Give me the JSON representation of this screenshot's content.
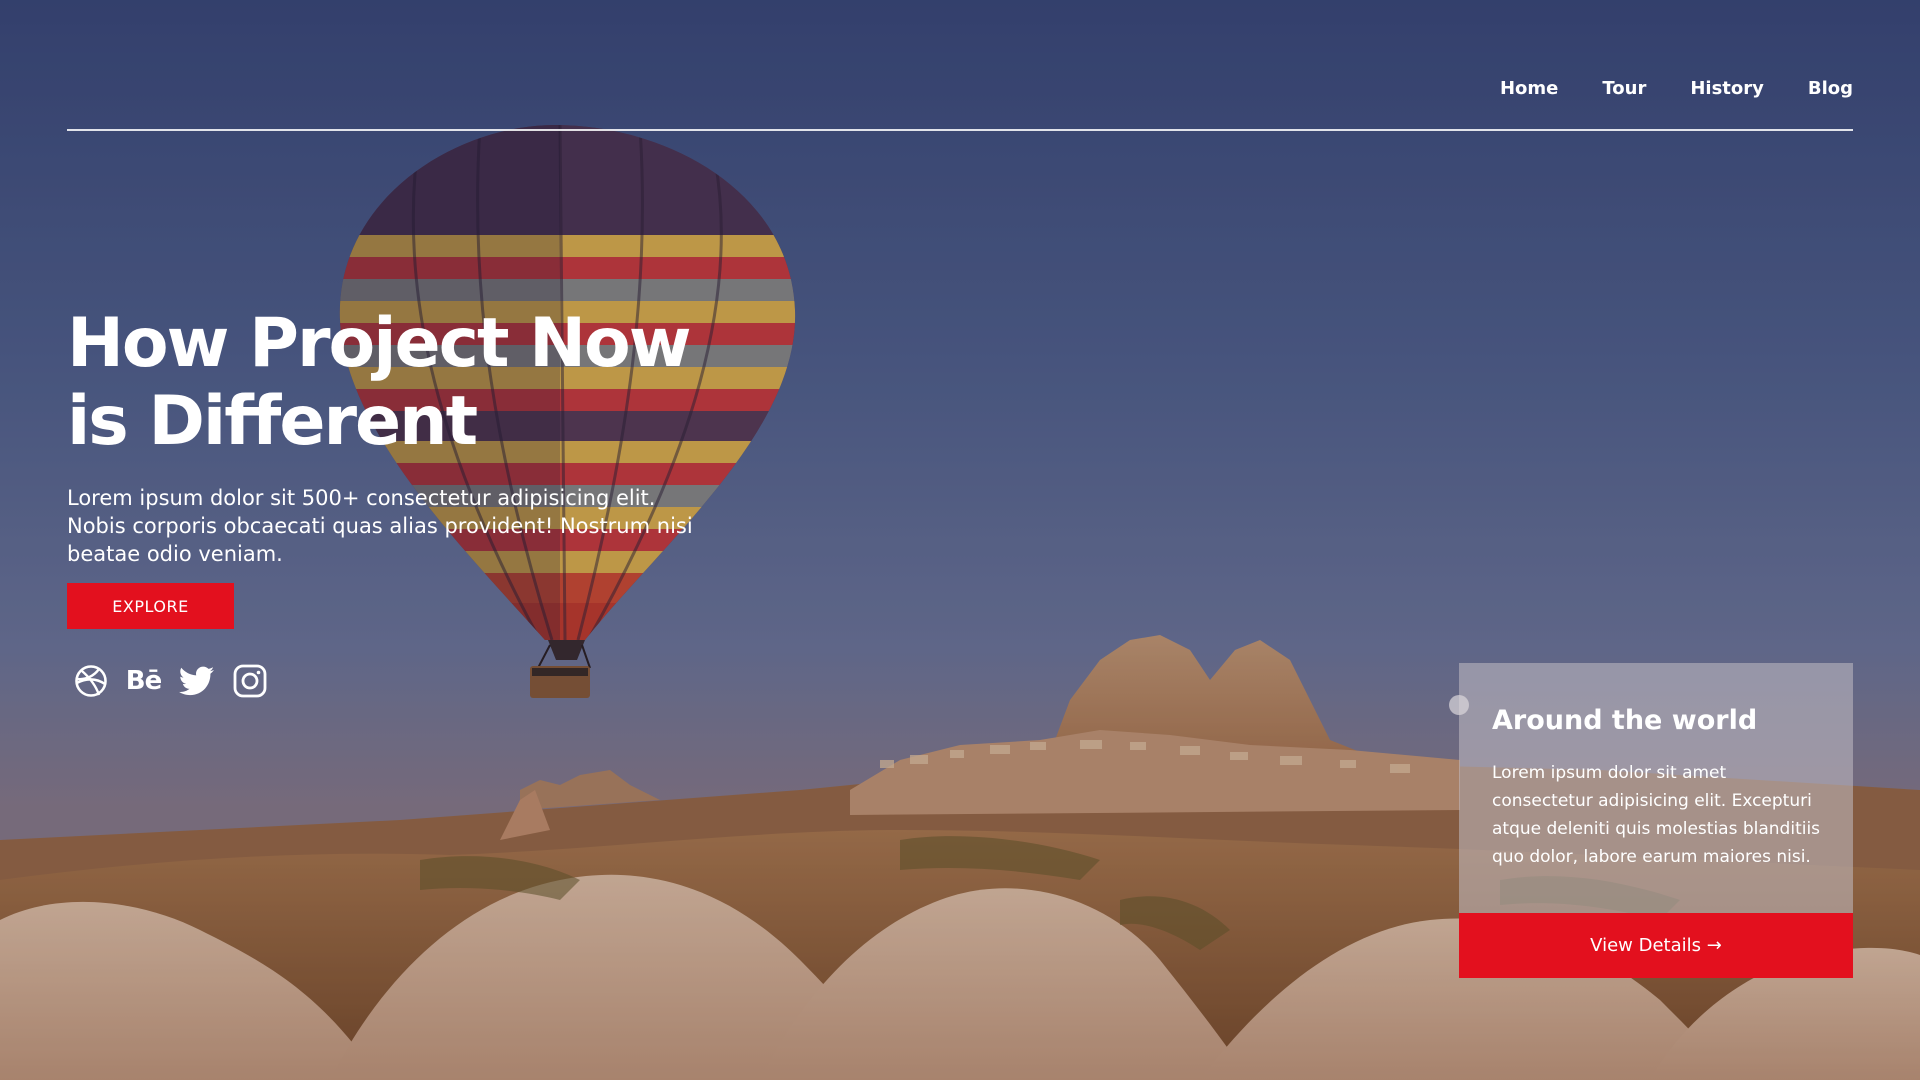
{
  "nav": {
    "items": [
      {
        "label": "Home"
      },
      {
        "label": "Tour"
      },
      {
        "label": "History"
      },
      {
        "label": "Blog"
      }
    ]
  },
  "hero": {
    "headline_line1": "How Project Now",
    "headline_line2": "is Different",
    "subtitle": "Lorem ipsum dolor sit 500+ consectetur adipisicing elit. Nobis corporis obcaecati quas alias provident! Nostrum nisi beatae odio veniam.",
    "explore_label": "EXPLORE"
  },
  "socials": [
    {
      "icon": "dribbble-icon"
    },
    {
      "icon": "behance-icon",
      "text": "Bē"
    },
    {
      "icon": "twitter-icon"
    },
    {
      "icon": "instagram-icon"
    }
  ],
  "card": {
    "title": "Around the world",
    "text": "Lorem ipsum dolor sit amet consectetur adipisicing elit. Excepturi atque deleniti quis molestias blanditiis quo dolor, labore earum maiores nisi.",
    "button_label": "View Details →"
  },
  "colors": {
    "accent": "#e3101e",
    "text": "#ffffff"
  }
}
